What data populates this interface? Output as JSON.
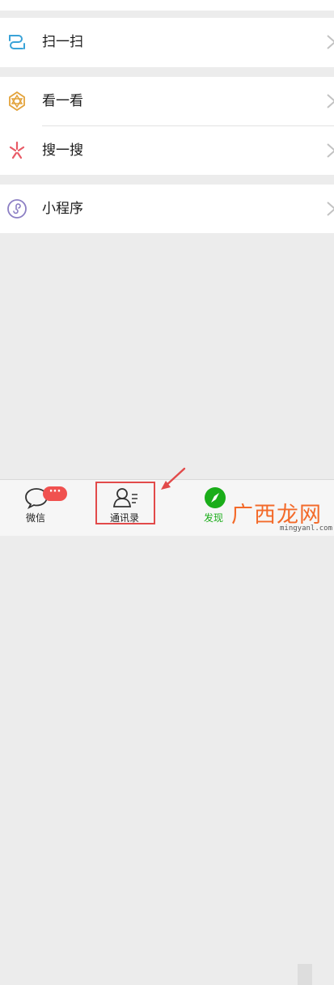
{
  "menu": {
    "scan": {
      "label": "扫一扫",
      "icon": "scan-icon"
    },
    "look": {
      "label": "看一看",
      "icon": "top-stories-icon"
    },
    "search": {
      "label": "搜一搜",
      "icon": "search-sparkle-icon"
    },
    "mini_programs": {
      "label": "小程序",
      "icon": "mini-program-icon"
    }
  },
  "tabbar": {
    "chats": {
      "label": "微信",
      "badge": "···",
      "icon": "chat-bubble-icon"
    },
    "contacts": {
      "label": "通讯录",
      "icon": "contacts-icon"
    },
    "discover": {
      "label": "发现",
      "icon": "compass-icon"
    }
  },
  "watermark": {
    "zh": "广西龙网",
    "url": "mingyanl.com"
  },
  "colors": {
    "accent_red": "#e24a4a",
    "discover_green": "#1aad19",
    "badge_red": "#f0514f",
    "watermark_orange": "#f36a2a"
  }
}
